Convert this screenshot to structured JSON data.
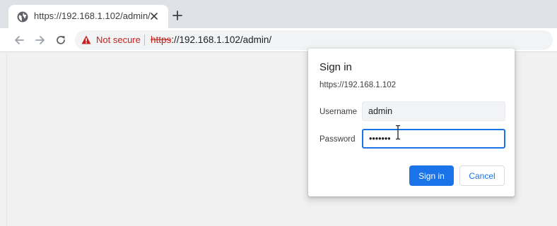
{
  "browser": {
    "tab": {
      "title": "https://192.168.1.102/admin/",
      "favicon": "globe-icon",
      "close_icon": "close-icon"
    },
    "new_tab_icon": "plus-icon",
    "toolbar": {
      "back_icon": "arrow-left-icon",
      "forward_icon": "arrow-right-icon",
      "reload_icon": "reload-icon"
    },
    "omnibox": {
      "security_icon": "warning-triangle-icon",
      "security_label": "Not secure",
      "url_scheme": "https",
      "url_rest": "://192.168.1.102/admin/"
    }
  },
  "dialog": {
    "title": "Sign in",
    "origin": "https://192.168.1.102",
    "username_label": "Username",
    "username_value": "admin",
    "password_label": "Password",
    "password_value": "•••••••",
    "signin_label": "Sign in",
    "cancel_label": "Cancel"
  },
  "colors": {
    "accent": "#1a73e8",
    "warning": "#c5221f",
    "tabstrip": "#dee1e6"
  }
}
